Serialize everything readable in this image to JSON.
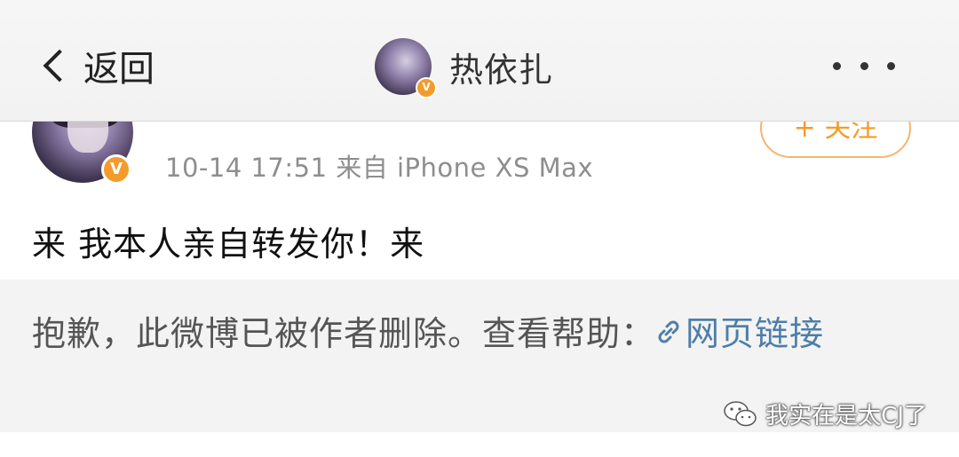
{
  "navbar": {
    "back_label": "返回",
    "title": "热依扎"
  },
  "post": {
    "meta": "10-14 17:51 来自 iPhone XS Max",
    "follow_label": "+ 关注",
    "text": "来 我本人亲自转发你！来"
  },
  "notice": {
    "text": "抱歉，此微博已被作者删除。查看帮助：",
    "link_label": "网页链接"
  },
  "watermark": {
    "text": "我实在是太CJ了"
  },
  "colors": {
    "accent_orange": "#f39c2b",
    "link_blue": "#4e7ea8",
    "notice_bg": "#f3f3f3"
  },
  "icons": [
    "chevron-left-icon",
    "more-dots-icon",
    "verified-badge-icon",
    "link-icon",
    "wechat-icon"
  ]
}
